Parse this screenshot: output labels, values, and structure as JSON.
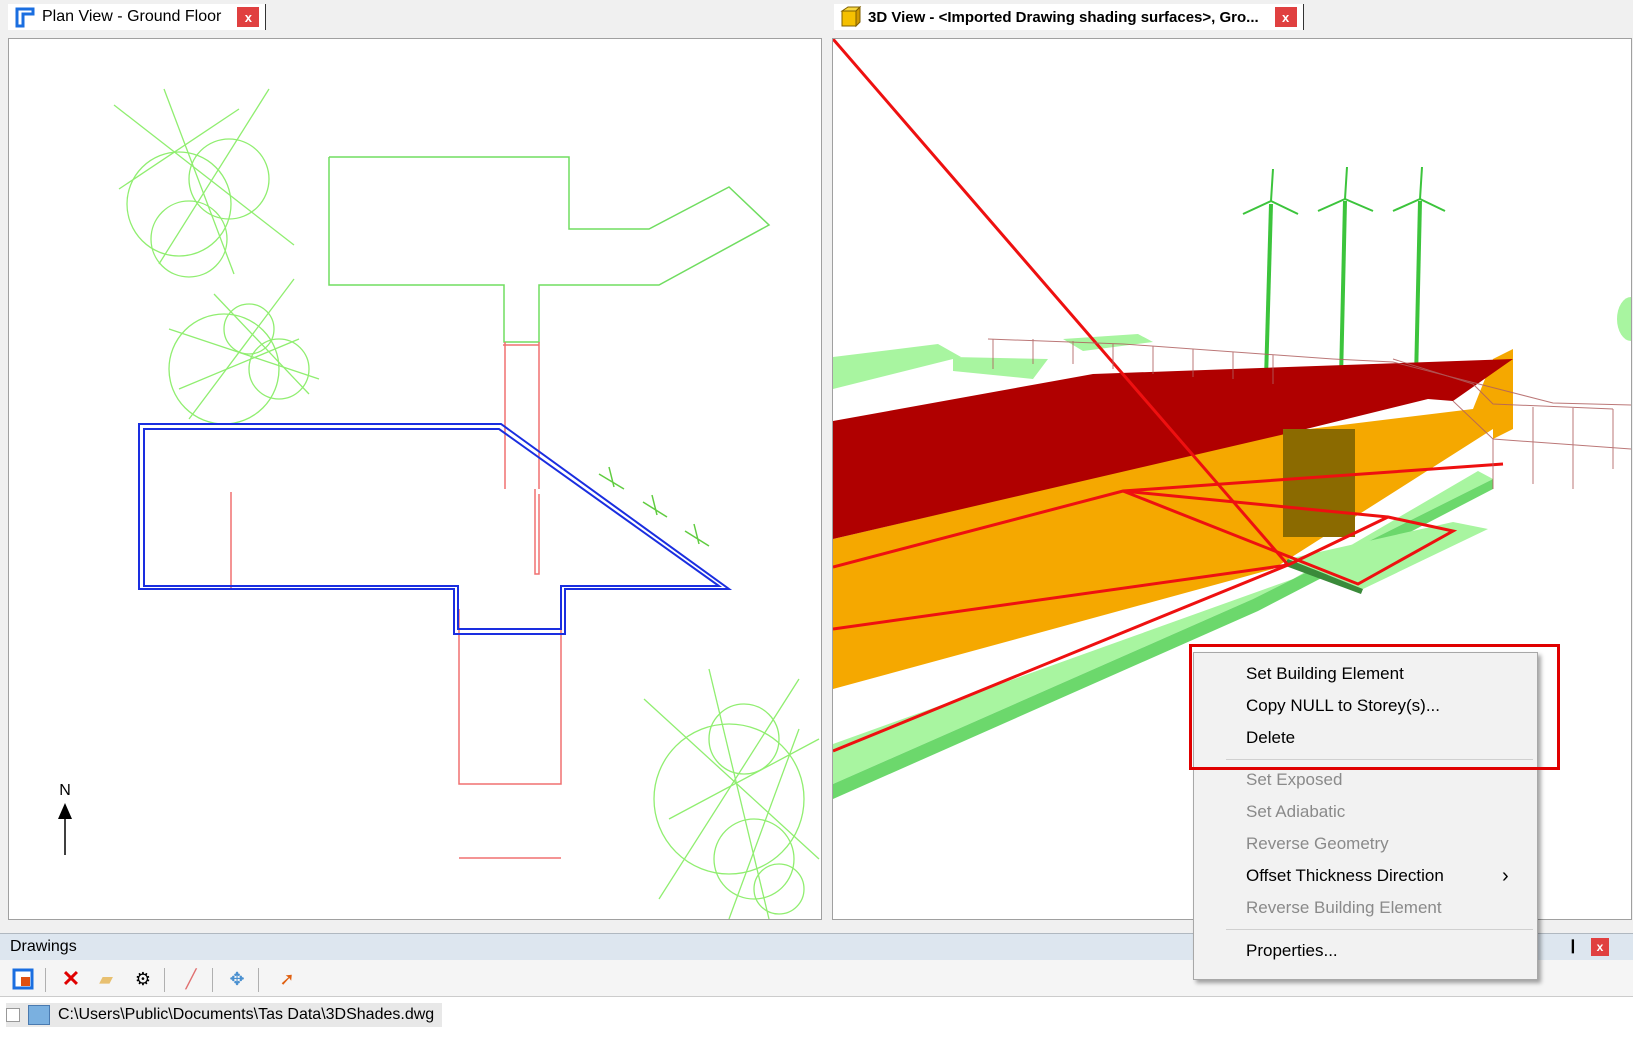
{
  "plan_view": {
    "tab_title": "Plan View - Ground Floor",
    "close_label": "x",
    "north_label": "N"
  },
  "view_3d": {
    "tab_title": "3D View - <Imported Drawing shading surfaces>, Gro...",
    "close_label": "x"
  },
  "drawings_panel": {
    "title": "Drawings",
    "pin_label": "❙",
    "close_label": "x",
    "file_path": "C:\\Users\\Public\\Documents\\Tas Data\\3DShades.dwg"
  },
  "toolbar_icons": [
    "add-drawing-icon",
    "delete-icon",
    "open-folder-icon",
    "settings-icon",
    "draw-icon",
    "move-icon",
    "import-icon"
  ],
  "context_menu": {
    "items": [
      {
        "label": "Set Building Element",
        "enabled": true
      },
      {
        "label": "Copy NULL to Storey(s)...",
        "enabled": true
      },
      {
        "label": "Delete",
        "enabled": true
      },
      {
        "label": "Set Exposed",
        "enabled": false
      },
      {
        "label": "Set Adiabatic",
        "enabled": false
      },
      {
        "label": "Reverse Geometry",
        "enabled": false
      },
      {
        "label": "Offset Thickness Direction",
        "enabled": true,
        "submenu_arrow": "›"
      },
      {
        "label": "Reverse Building Element",
        "enabled": false
      },
      {
        "label": "Properties...",
        "enabled": true
      }
    ]
  },
  "colors": {
    "accent_highlight": "#e00000",
    "roof_red": "#b00000",
    "wall_orange": "#f5a800",
    "ground_green": "#a8f5a0",
    "plan_outline_blue": "#1a2ee0",
    "plan_tree_green": "#90ee70"
  }
}
